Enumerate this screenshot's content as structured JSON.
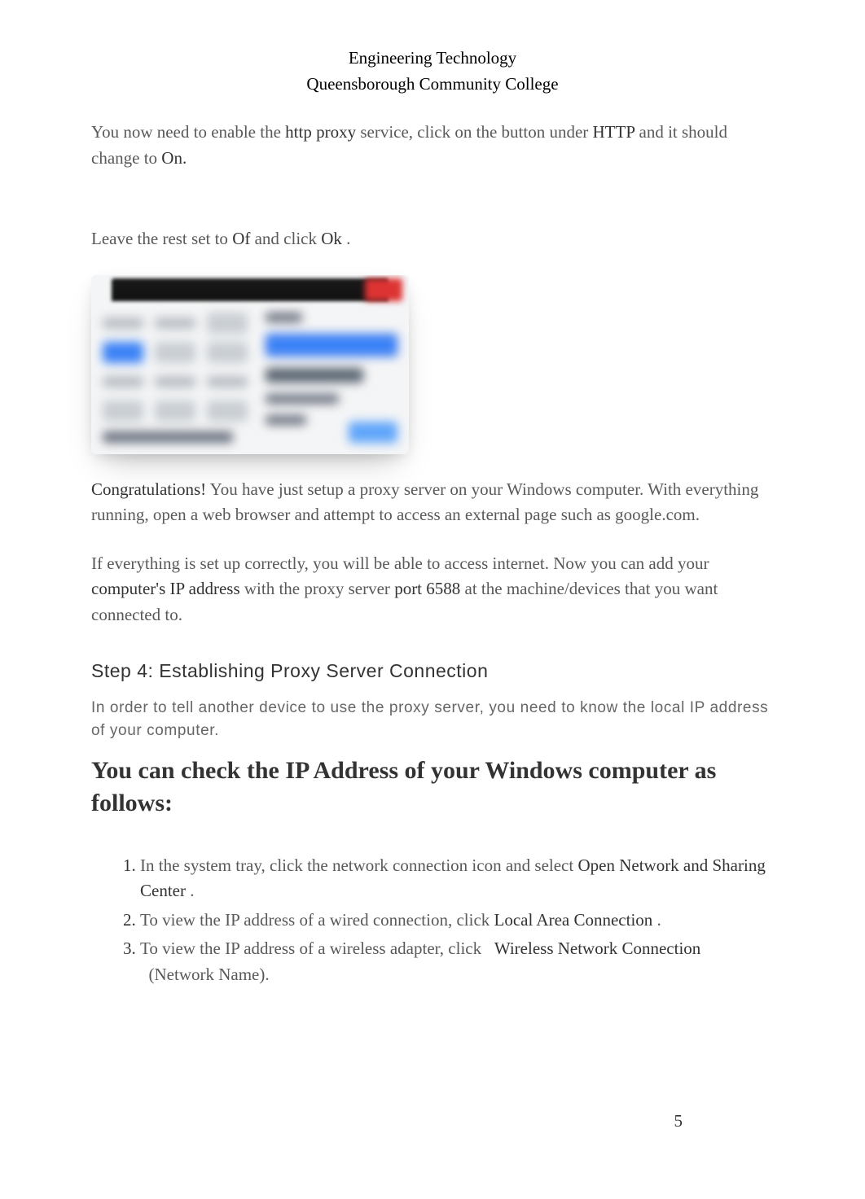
{
  "header": {
    "line1": "Engineering Technology",
    "line2": "Queensborough Community College"
  },
  "p1": {
    "t1": "You now need to enable the ",
    "t2": "http proxy",
    "t3": " service, click on the button under ",
    "t4": "HTTP",
    "t5": " and it should change to ",
    "t6": "On."
  },
  "p2": {
    "t1": "Leave the rest set to ",
    "t2": "Of",
    "t3": " and click ",
    "t4": "Ok",
    "t5": "."
  },
  "p3": {
    "t1": "Congratulations!",
    "t2": " You have just setup a proxy server on your Windows computer. With everything running, open a web browser and attempt to access an external page such as google.com."
  },
  "p4": {
    "t1": "If everything is set up correctly, you will be able to access internet. Now you can add your ",
    "t2": "computer's IP address",
    "t3": " with the proxy server ",
    "t4": "port 6588",
    "t5": " at the machine/devices that you want connected to."
  },
  "step": {
    "heading": "Step 4: Establishing Proxy Server Connection",
    "intro": "In order to tell another device to use the proxy server, you need to know the local IP address of your computer.",
    "subheading": "You can check the IP Address of your Windows computer as follows:"
  },
  "list": {
    "i1": {
      "a": "In the system tray, click the network connection icon and select ",
      "b": "Open Network and Sharing Center",
      "c": "."
    },
    "i2": {
      "a": "To view the IP address of a wired connection, click ",
      "b": "Local Area Connection",
      "c": "."
    },
    "i3": {
      "a": "To view the IP address of a wireless adapter, click",
      "b": "Wireless Network Connection",
      "c": "(Network Name)."
    }
  },
  "pageNumber": "5"
}
